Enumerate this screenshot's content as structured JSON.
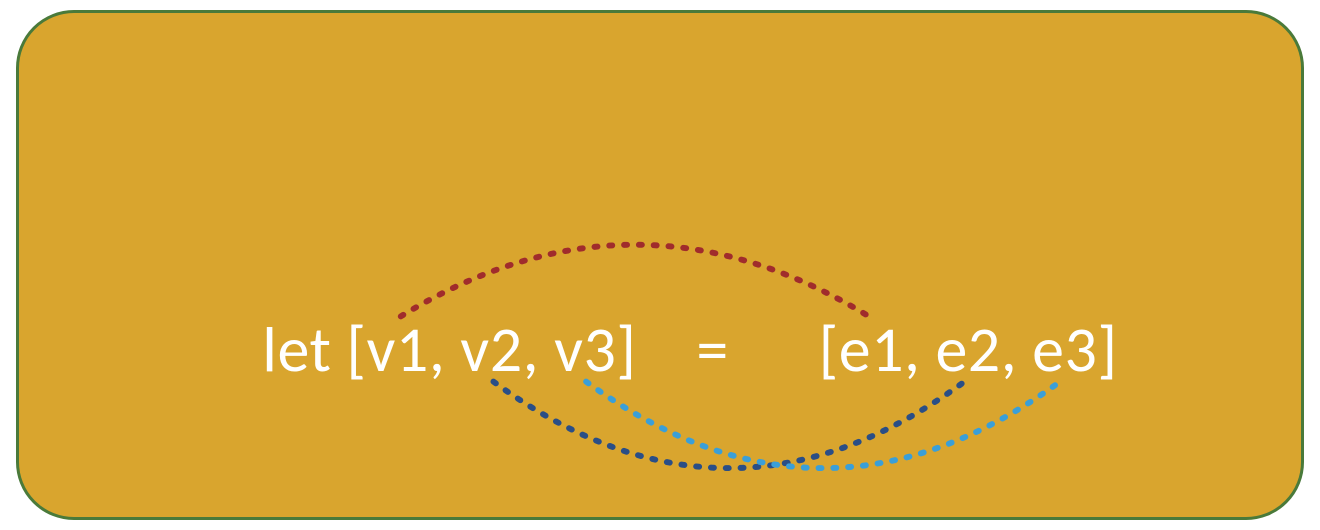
{
  "code": {
    "let": "let ",
    "lb1": "[",
    "v1": "v1",
    "c1": ", ",
    "v2": "v2",
    "c2": ", ",
    "v3": "v3",
    "rb1": "]    ",
    "eq": "=",
    "sp": "      ",
    "lb2": "[",
    "e1": "e1",
    "c3": ", ",
    "e2": "e2",
    "c4": ", ",
    "e3": "e3",
    "rb2": "]"
  },
  "colors": {
    "panel_bg": "#d9a52e",
    "panel_border": "#4a7a3a",
    "text": "#ffffff",
    "arc_v1_e1": "#a02c2c",
    "arc_v2_e2": "#2a4e86",
    "arc_v3_e3": "#3a9fd8"
  },
  "connections": [
    {
      "from": "v1",
      "to": "e1",
      "side": "above",
      "color_key": "arc_v1_e1"
    },
    {
      "from": "v2",
      "to": "e2",
      "side": "below",
      "color_key": "arc_v2_e2"
    },
    {
      "from": "v3",
      "to": "e3",
      "side": "below",
      "color_key": "arc_v3_e3"
    }
  ]
}
